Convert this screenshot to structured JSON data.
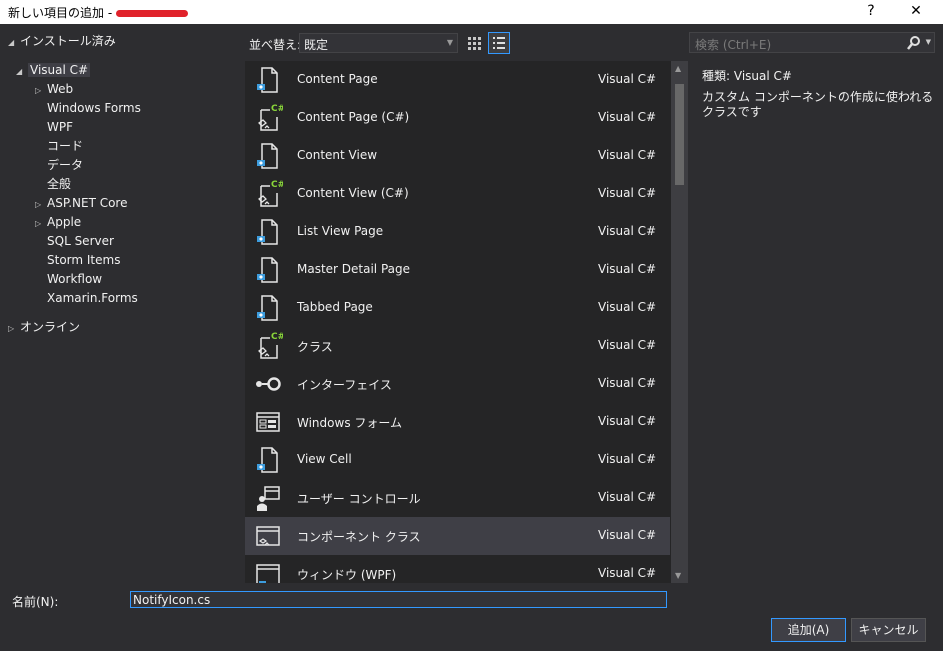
{
  "window": {
    "title": "新しい項目の追加 -",
    "help_label": "?",
    "close_label": "✕"
  },
  "tree": {
    "installed": "インストール済み",
    "root": "Visual C#",
    "children": [
      "Web",
      "Windows Forms",
      "WPF",
      "コード",
      "データ",
      "全般",
      "ASP.NET Core",
      "Apple",
      "SQL Server",
      "Storm Items",
      "Workflow",
      "Xamarin.Forms"
    ],
    "online": "オンライン"
  },
  "toolbar": {
    "sort_label": "並べ替え:",
    "sort_value": "既定",
    "search_placeholder": "検索 (Ctrl+E)"
  },
  "templates": [
    {
      "name": "Content Page",
      "lang": "Visual C#",
      "icon": "page-icon"
    },
    {
      "name": "Content Page (C#)",
      "lang": "Visual C#",
      "icon": "cs-class-icon"
    },
    {
      "name": "Content View",
      "lang": "Visual C#",
      "icon": "page-icon"
    },
    {
      "name": "Content View (C#)",
      "lang": "Visual C#",
      "icon": "cs-class-icon"
    },
    {
      "name": "List View Page",
      "lang": "Visual C#",
      "icon": "page-icon"
    },
    {
      "name": "Master Detail Page",
      "lang": "Visual C#",
      "icon": "page-icon"
    },
    {
      "name": "Tabbed Page",
      "lang": "Visual C#",
      "icon": "page-icon"
    },
    {
      "name": "クラス",
      "lang": "Visual C#",
      "icon": "cs-class-icon"
    },
    {
      "name": "インターフェイス",
      "lang": "Visual C#",
      "icon": "interface-icon"
    },
    {
      "name": "Windows フォーム",
      "lang": "Visual C#",
      "icon": "form-icon"
    },
    {
      "name": "View Cell",
      "lang": "Visual C#",
      "icon": "page-icon"
    },
    {
      "name": "ユーザー コントロール",
      "lang": "Visual C#",
      "icon": "user-control-icon"
    },
    {
      "name": "コンポーネント クラス",
      "lang": "Visual C#",
      "icon": "component-icon"
    },
    {
      "name": "ウィンドウ (WPF)",
      "lang": "Visual C#",
      "icon": "window-icon"
    }
  ],
  "selected_index": 12,
  "details": {
    "type_label": "種類:",
    "type_value": "Visual C#",
    "description": "カスタム コンポーネントの作成に使われるクラスです"
  },
  "footer": {
    "name_label": "名前(N):",
    "name_value": "NotifyIcon.cs",
    "add_label": "追加(A)",
    "cancel_label": "キャンセル"
  },
  "colors": {
    "accent": "#3399ff",
    "icon_blue": "#3d9dde",
    "cs_green": "#8ad63a"
  }
}
